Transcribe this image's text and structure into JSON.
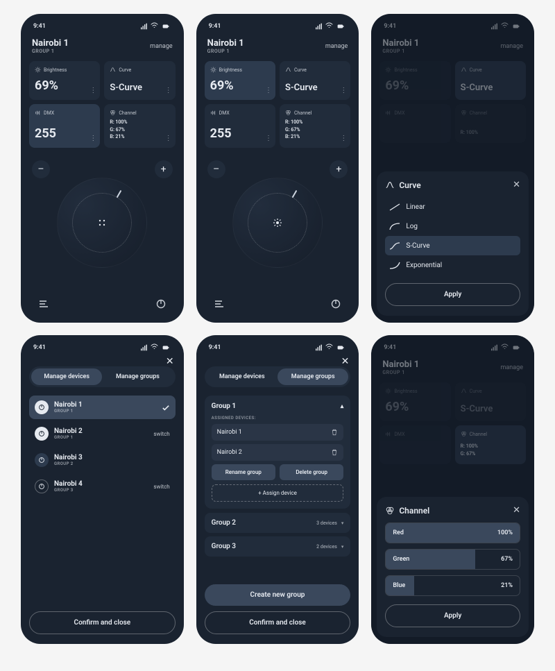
{
  "status": {
    "time": "9:41",
    "signal": "▪▪▪▪",
    "wifi": "wifi",
    "battery": "bat"
  },
  "header": {
    "title": "Nairobi 1",
    "subtitle": "GROUP 1",
    "manage": "manage"
  },
  "tiles": {
    "brightness": {
      "label": "Brightness",
      "value": "69%"
    },
    "curve": {
      "label": "Curve",
      "value": "S-Curve"
    },
    "dmx": {
      "label": "DMX",
      "value": "255"
    },
    "channel": {
      "label": "Channel",
      "r": "R: 100%",
      "g": "G: 67%",
      "b": "B: 21%"
    }
  },
  "dial": {
    "minus": "–",
    "plus": "+"
  },
  "curve_sheet": {
    "title": "Curve",
    "options": [
      "Linear",
      "Log",
      "S-Curve",
      "Exponential"
    ],
    "selected": "S-Curve",
    "apply": "Apply"
  },
  "manage_panel": {
    "tabs": [
      "Manage devices",
      "Manage groups"
    ],
    "devices": [
      {
        "name": "Nairobi 1",
        "group": "GROUP 1",
        "state": "selected",
        "action": "check"
      },
      {
        "name": "Nairobi 2",
        "group": "GROUP 1",
        "state": "on",
        "action": "switch"
      },
      {
        "name": "Nairobi 3",
        "group": "GROUP 2",
        "state": "dim",
        "action": ""
      },
      {
        "name": "Nairobi 4",
        "group": "GROUP 3",
        "state": "off",
        "action": "switch"
      }
    ],
    "switch_label": "switch",
    "confirm": "Confirm and close"
  },
  "groups_panel": {
    "tabs": [
      "Manage devices",
      "Manage groups"
    ],
    "expanded": {
      "name": "Group 1",
      "assigned_label": "ASSIGNED DEVICES:",
      "devices": [
        "Nairobi 1",
        "Nairobi 2"
      ],
      "rename": "Rename group",
      "delete": "Delete group",
      "assign": "+ Assign device"
    },
    "collapsed": [
      {
        "name": "Group 2",
        "meta": "3 devices"
      },
      {
        "name": "Group 3",
        "meta": "2 devices"
      }
    ],
    "create": "Create new group",
    "confirm": "Confirm and close"
  },
  "channel_sheet": {
    "title": "Channel",
    "rows": [
      {
        "name": "Red",
        "pct": 100,
        "label": "100%"
      },
      {
        "name": "Green",
        "pct": 67,
        "label": "67%"
      },
      {
        "name": "Blue",
        "pct": 21,
        "label": "21%"
      }
    ],
    "apply": "Apply"
  }
}
